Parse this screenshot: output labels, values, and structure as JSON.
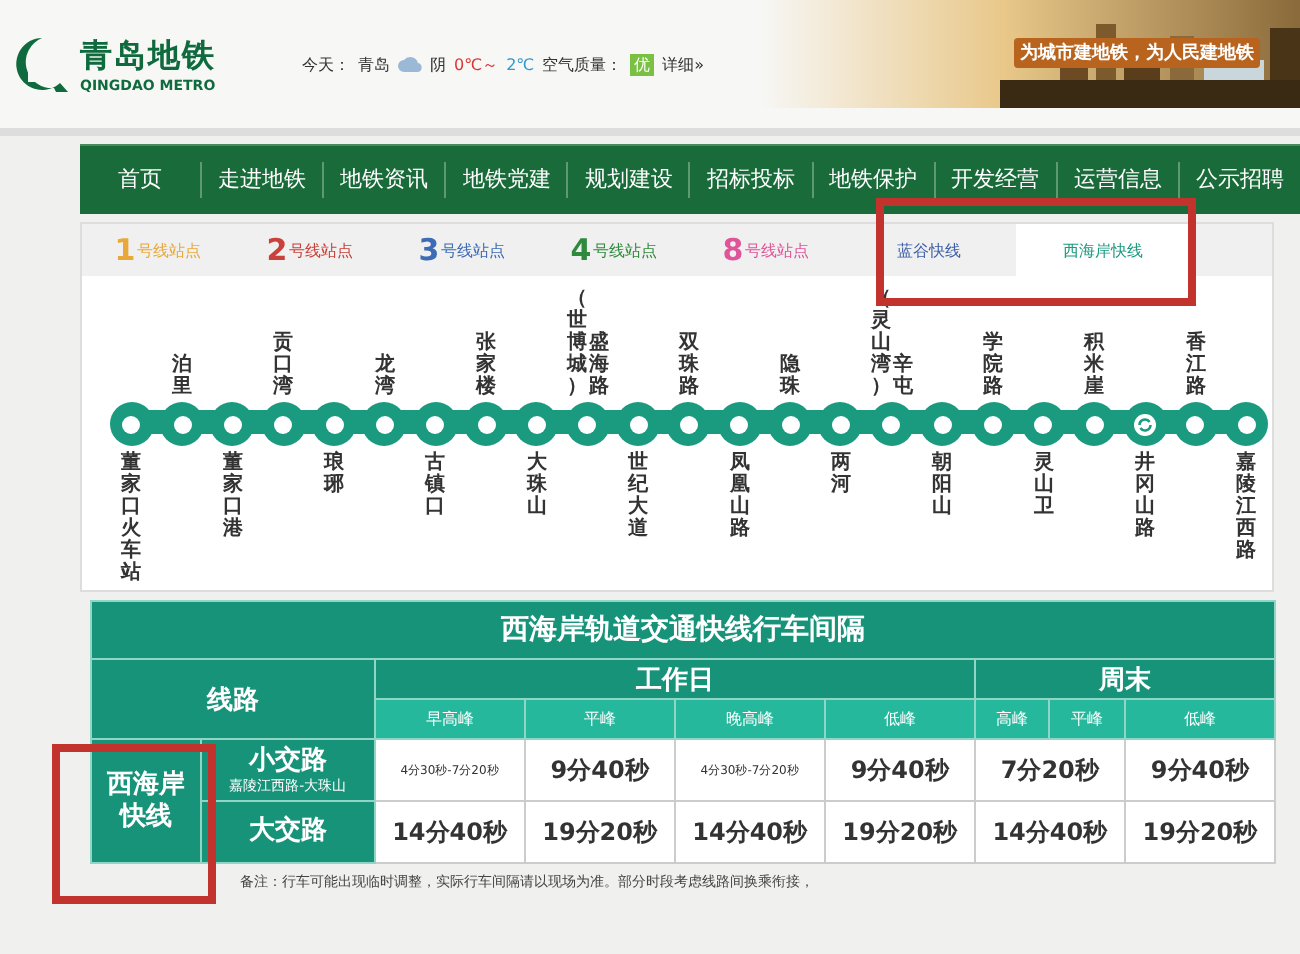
{
  "header": {
    "logo_cn": "青岛地铁",
    "logo_en": "QINGDAO METRO",
    "weather": {
      "label": "今天：",
      "city": "青岛",
      "condition": "阴",
      "low": "0℃～",
      "high": "2℃",
      "aqi_label": "空气质量：",
      "aqi": "优",
      "details": "详细»"
    },
    "slogan": "为城市建地铁，为人民建地铁"
  },
  "nav": [
    "首页",
    "走进地铁",
    "地铁资讯",
    "地铁党建",
    "规划建设",
    "招标投标",
    "地铁保护",
    "开发经营",
    "运营信息",
    "公示招聘"
  ],
  "tabs": [
    {
      "number": "1",
      "label": "号线站点",
      "color": "#e8a93a",
      "selected": false
    },
    {
      "number": "2",
      "label": "号线站点",
      "color": "#c8413a",
      "selected": false
    },
    {
      "number": "3",
      "label": "号线站点",
      "color": "#3d6bb5",
      "selected": false
    },
    {
      "number": "4",
      "label": "号线站点",
      "color": "#2f8a3e",
      "selected": false
    },
    {
      "number": "8",
      "label": "号线站点",
      "color": "#e0559a",
      "selected": false
    },
    {
      "label": "蓝谷快线",
      "color": "#3d5fa8",
      "selected": false
    },
    {
      "label": "西海岸快线",
      "color": "#1a9a7f",
      "selected": true
    }
  ],
  "stations": [
    {
      "name": "董家口火车站",
      "transfer": false
    },
    {
      "name": "泊里",
      "transfer": false
    },
    {
      "name": "董家口港",
      "transfer": false
    },
    {
      "name": "贡口湾",
      "transfer": false
    },
    {
      "name": "琅琊",
      "transfer": false
    },
    {
      "name": "龙湾",
      "transfer": false
    },
    {
      "name": "古镇口",
      "transfer": false
    },
    {
      "name": "张家楼",
      "transfer": false
    },
    {
      "name": "大珠山",
      "transfer": false
    },
    {
      "name": "盛海路",
      "alias": "（世博城）",
      "transfer": false
    },
    {
      "name": "世纪大道",
      "transfer": false
    },
    {
      "name": "双珠路",
      "transfer": false
    },
    {
      "name": "凤凰山路",
      "transfer": false
    },
    {
      "name": "隐珠",
      "transfer": false
    },
    {
      "name": "两河",
      "transfer": false
    },
    {
      "name": "辛屯",
      "alias": "（灵山湾）",
      "transfer": false
    },
    {
      "name": "朝阳山",
      "transfer": false
    },
    {
      "name": "学院路",
      "transfer": false
    },
    {
      "name": "灵山卫",
      "transfer": false
    },
    {
      "name": "积米崖",
      "transfer": false
    },
    {
      "name": "井冈山路",
      "transfer": true
    },
    {
      "name": "香江路",
      "transfer": false
    },
    {
      "name": "嘉陵江西路",
      "transfer": false
    }
  ],
  "table": {
    "title": "西海岸轨道交通快线行车间隔",
    "route_header": "线路",
    "line_name": "西海岸快线",
    "groups": [
      {
        "label": "工作日",
        "periods": [
          "早高峰",
          "平峰",
          "晚高峰",
          "低峰"
        ]
      },
      {
        "label": "周末",
        "periods": [
          "高峰",
          "平峰",
          "低峰"
        ]
      }
    ],
    "rows": [
      {
        "name": "小交路",
        "sub": "嘉陵江西路-大珠山",
        "cells": [
          {
            "text": "4分30秒-7分20秒",
            "kind": "range"
          },
          {
            "text": "9分40秒"
          },
          {
            "text": "4分30秒-7分20秒",
            "kind": "range"
          },
          {
            "text": "9分40秒"
          },
          {
            "text": "7分20秒",
            "merged": true
          },
          {
            "text": "9分40秒"
          }
        ]
      },
      {
        "name": "大交路",
        "cells": [
          {
            "text": "14分40秒"
          },
          {
            "text": "19分20秒"
          },
          {
            "text": "14分40秒"
          },
          {
            "text": "19分20秒"
          },
          {
            "text": "14分40秒",
            "merged": true
          },
          {
            "text": "19分20秒"
          }
        ]
      }
    ],
    "note": "备注：行车可能出现临时调整，实际行车间隔请以现场为准。部分时段考虑线路间换乘衔接，"
  }
}
